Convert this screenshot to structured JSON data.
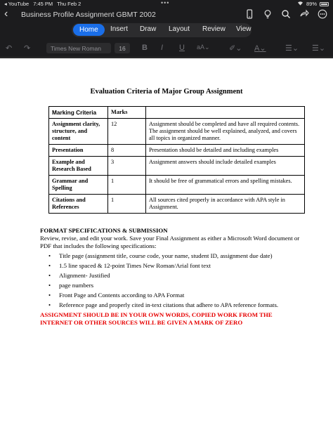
{
  "status": {
    "carrier": "◂ YouTube",
    "time": "7:45 PM",
    "date": "Thu Feb 2",
    "battery": "89%"
  },
  "titlebar": {
    "title": "Business Profile Assignment GBMT 2002"
  },
  "tabs": [
    "Home",
    "Insert",
    "Draw",
    "Layout",
    "Review",
    "View"
  ],
  "toolbar": {
    "font_name": "Times New Roman",
    "font_size": "16",
    "bold": "B",
    "italic": "I",
    "underline": "U"
  },
  "document": {
    "heading": "Evaluation Criteria of Major Group Assignment",
    "table": {
      "headers": [
        "Marking Criteria",
        "Marks",
        ""
      ],
      "rows": [
        {
          "criteria": "Assignment clarity, structure, and content",
          "marks": "12",
          "description": "Assignment should be completed and have all required contents. The assignment should be well explained, analyzed, and covers all topics in organized manner."
        },
        {
          "criteria": "Presentation",
          "marks": "8",
          "description": "Presentation should be detailed and including examples"
        },
        {
          "criteria": "Example and Research Based",
          "marks": "3",
          "description": "Assignment answers should include detailed examples"
        },
        {
          "criteria": "Grammar and Spelling",
          "marks": "1",
          "description": "It should be free of grammatical errors and spelling mistakes."
        },
        {
          "criteria": "Citations and References",
          "marks": "1",
          "description": "All sources cited properly in accordance with APA style in Assignment."
        }
      ]
    },
    "format_heading": "FORMAT SPECIFICATIONS & SUBMISSION",
    "format_intro": "Review, revise, and edit your work. Save your Final Assignment as either a Microsoft Word document or PDF that includes the following specifications:",
    "bullets": [
      "Title page (assignment title, course code, your name, student ID, assignment due date)",
      "1.5 line spaced & 12-point Times New Roman/Arial font text",
      "Alignment- Justified",
      "page numbers",
      "Front Page and Contents according to APA Format",
      "Reference page and properly cited in-text citations that adhere to APA reference formats."
    ],
    "warning": "ASSIGNMENT SHOULD BE IN YOUR OWN WORDS, COPIED WORK FROM THE INTERNET OR OTHER SOURCES WILL BE GIVEN A MARK OF ZERO"
  }
}
